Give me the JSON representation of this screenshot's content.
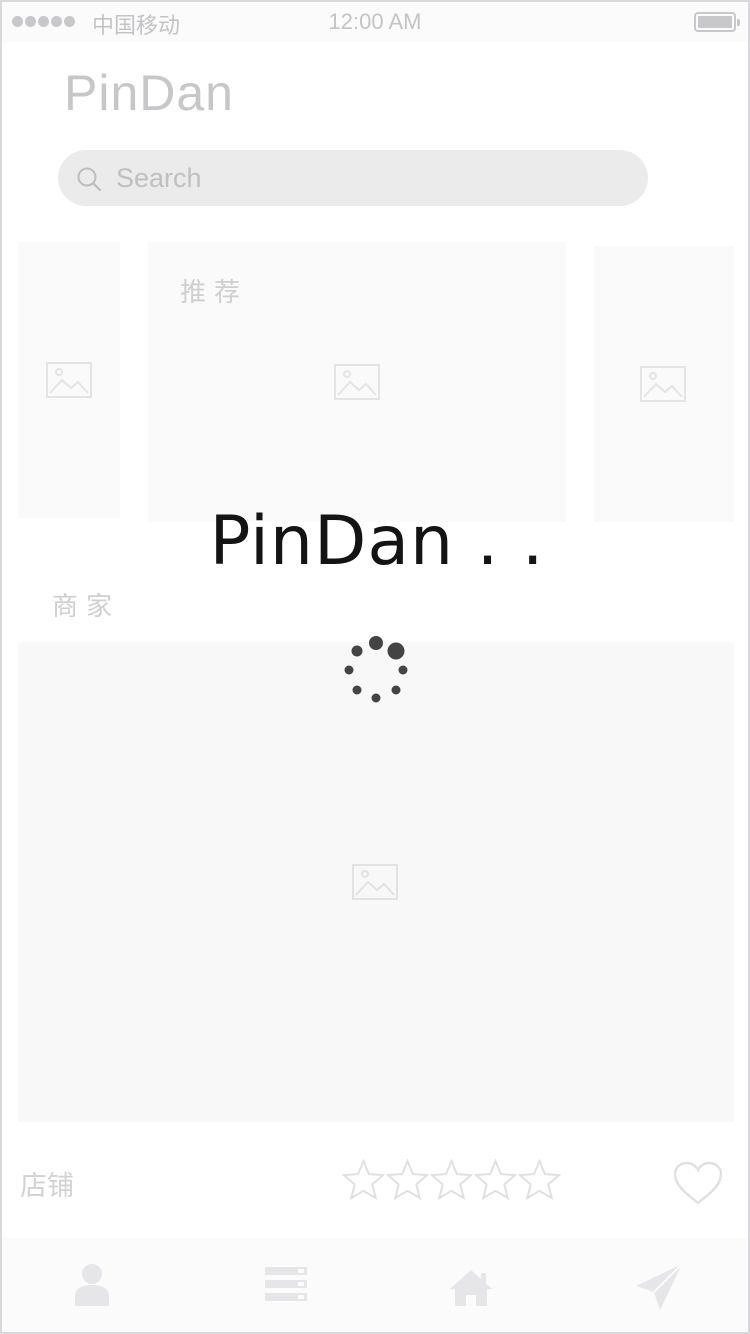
{
  "status_bar": {
    "carrier": "中国移动",
    "time": "12:00 AM",
    "signal_bars": 5
  },
  "header": {
    "app_title": "PinDan"
  },
  "search": {
    "placeholder": "Search",
    "icon": "search-icon"
  },
  "recommend": {
    "label": "推荐",
    "cards": [
      {
        "name": "recommend-card-left",
        "icon": "image-placeholder-icon"
      },
      {
        "name": "recommend-card-main",
        "icon": "image-placeholder-icon"
      },
      {
        "name": "recommend-card-right",
        "icon": "image-placeholder-icon"
      }
    ]
  },
  "merchants": {
    "label": "商家",
    "card_icon": "image-placeholder-icon"
  },
  "shop": {
    "label": "店铺",
    "rating": 0,
    "rating_max": 5,
    "favorite_icon": "heart-icon"
  },
  "tab_bar": {
    "tabs": [
      {
        "name": "tab-profile",
        "icon": "user-icon"
      },
      {
        "name": "tab-list",
        "icon": "list-icon"
      },
      {
        "name": "tab-home",
        "icon": "home-icon"
      },
      {
        "name": "tab-send",
        "icon": "paper-plane-icon"
      }
    ]
  },
  "loading": {
    "text": "PinDan . .",
    "icon": "spinner-icon"
  },
  "colors": {
    "faded_gray": "#c7c7c9",
    "card_bg": "#fafafb",
    "overlay_text": "#141414",
    "spinner": "#444444"
  }
}
